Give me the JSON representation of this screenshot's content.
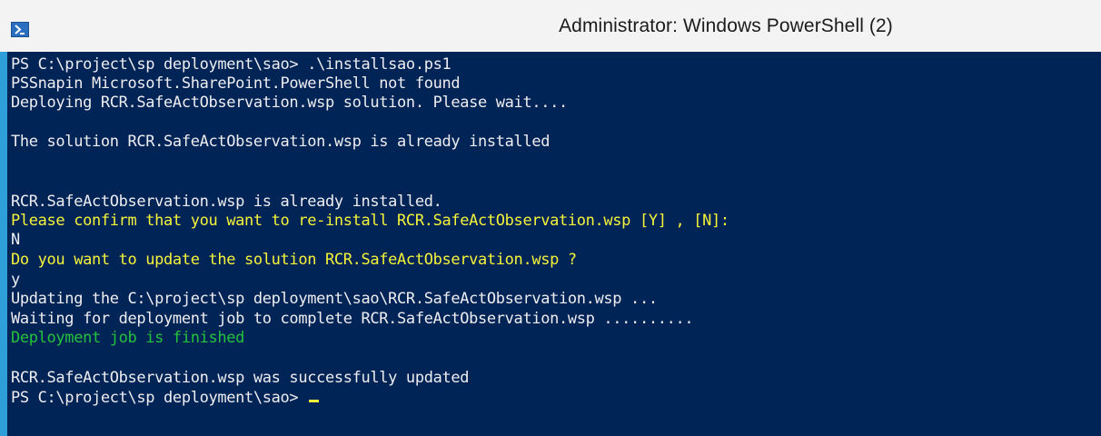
{
  "window": {
    "title": "Administrator: Windows PowerShell (2)",
    "icon": "powershell-icon"
  },
  "colors": {
    "console_bg": "#012456",
    "text_default": "#eeedf0",
    "text_warning": "#f5f33a",
    "text_success": "#24c23c"
  },
  "console": {
    "lines": [
      "PS C:\\project\\sp deployment\\sao> .\\installsao.ps1",
      "PSSnapin Microsoft.SharePoint.PowerShell not found",
      "Deploying RCR.SafeActObservation.wsp solution. Please wait....",
      "",
      "The solution RCR.SafeActObservation.wsp is already installed",
      "",
      "",
      "RCR.SafeActObservation.wsp is already installed.",
      "Please confirm that you want to re-install RCR.SafeActObservation.wsp [Y] , [N]:",
      "N",
      "Do you want to update the solution RCR.SafeActObservation.wsp ?",
      "y",
      "Updating the C:\\project\\sp deployment\\sao\\RCR.SafeActObservation.wsp ...",
      "Waiting for deployment job to complete RCR.SafeActObservation.wsp ..........",
      "Deployment job is finished",
      "",
      "RCR.SafeActObservation.wsp was successfully updated",
      "PS C:\\project\\sp deployment\\sao> "
    ]
  }
}
